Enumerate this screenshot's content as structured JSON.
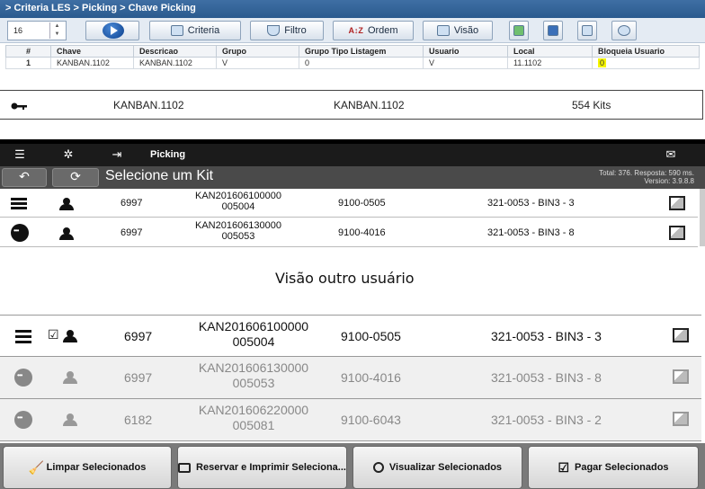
{
  "les": {
    "breadcrumb": "> Criteria LES > Picking > Chave Picking",
    "page_size": "16",
    "buttons": {
      "criteria": "Criteria",
      "filtro": "Filtro",
      "ordem": "Ordem",
      "visao": "Visão"
    },
    "columns": [
      "#",
      "Chave",
      "Descricao",
      "Grupo",
      "Grupo Tipo Listagem",
      "Usuario",
      "Local",
      "Bloqueia Usuario"
    ],
    "rows": [
      {
        "num": "1",
        "chave": "KANBAN.1102",
        "descricao": "KANBAN.1102",
        "grupo": "V",
        "grupo_tipo": "0",
        "usuario": "V",
        "local": "11.1102",
        "bloqueia": "0"
      }
    ]
  },
  "key_row": {
    "chave": "KANBAN.1102",
    "descricao": "KANBAN.1102",
    "kits": "554 Kits"
  },
  "app": {
    "bar_title": "Picking",
    "page_title": "Selecione um Kit",
    "info_line1": "Total: 376. Resposta: 590 ms.",
    "info_line2": "Version: 3.9.8.8",
    "rows": [
      {
        "id": "6997",
        "code1": "KAN201606100000",
        "code2": "005004",
        "part": "9100-0505",
        "bin": "321-0053 - BIN3 - 3"
      },
      {
        "id": "6997",
        "code1": "KAN201606130000",
        "code2": "005053",
        "part": "9100-4016",
        "bin": "321-0053 - BIN3 - 8"
      }
    ]
  },
  "caption": "Visão outro usuário",
  "other_view": {
    "rows": [
      {
        "id": "6997",
        "code1": "KAN201606100000",
        "code2": "005004",
        "part": "9100-0505",
        "bin": "321-0053 - BIN3 - 3"
      },
      {
        "id": "6997",
        "code1": "KAN201606130000",
        "code2": "005053",
        "part": "9100-4016",
        "bin": "321-0053 - BIN3 - 8"
      },
      {
        "id": "6182",
        "code1": "KAN201606220000",
        "code2": "005081",
        "part": "9100-6043",
        "bin": "321-0053 - BIN3 - 2"
      }
    ]
  },
  "actions": {
    "limpar": "Limpar Selecionados",
    "reservar": "Reservar e Imprimir Seleciona...",
    "visualizar": "Visualizar Selecionados",
    "pagar": "Pagar Selecionados"
  }
}
